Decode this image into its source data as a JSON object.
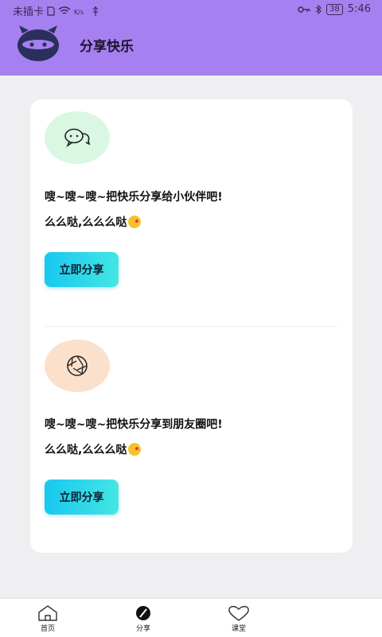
{
  "status_bar": {
    "carrier": "未插卡",
    "battery": "38",
    "time": "5:46"
  },
  "header": {
    "title": "分享快乐"
  },
  "share_items": [
    {
      "icon": "wechat-chat-icon",
      "line1": "嗖~嗖~嗖~把快乐分享给小伙伴吧!",
      "line2": "么么哒,么么么哒",
      "button": "立即分享",
      "circle_color": "#d9f7e2"
    },
    {
      "icon": "camera-shutter-icon",
      "line1": "嗖~嗖~嗖~把快乐分享到朋友圈吧!",
      "line2": "么么哒,么么么哒",
      "button": "立即分享",
      "circle_color": "#fbe0cc"
    }
  ],
  "bottom_nav": [
    {
      "label": "首页",
      "icon": "home-icon"
    },
    {
      "label": "分享",
      "icon": "compass-icon",
      "active": true
    },
    {
      "label": "课堂",
      "icon": "heart-icon"
    }
  ],
  "colors": {
    "header_bg": "#a680f0",
    "button_gradient_start": "#18c8ee",
    "button_gradient_end": "#43e6e4"
  }
}
